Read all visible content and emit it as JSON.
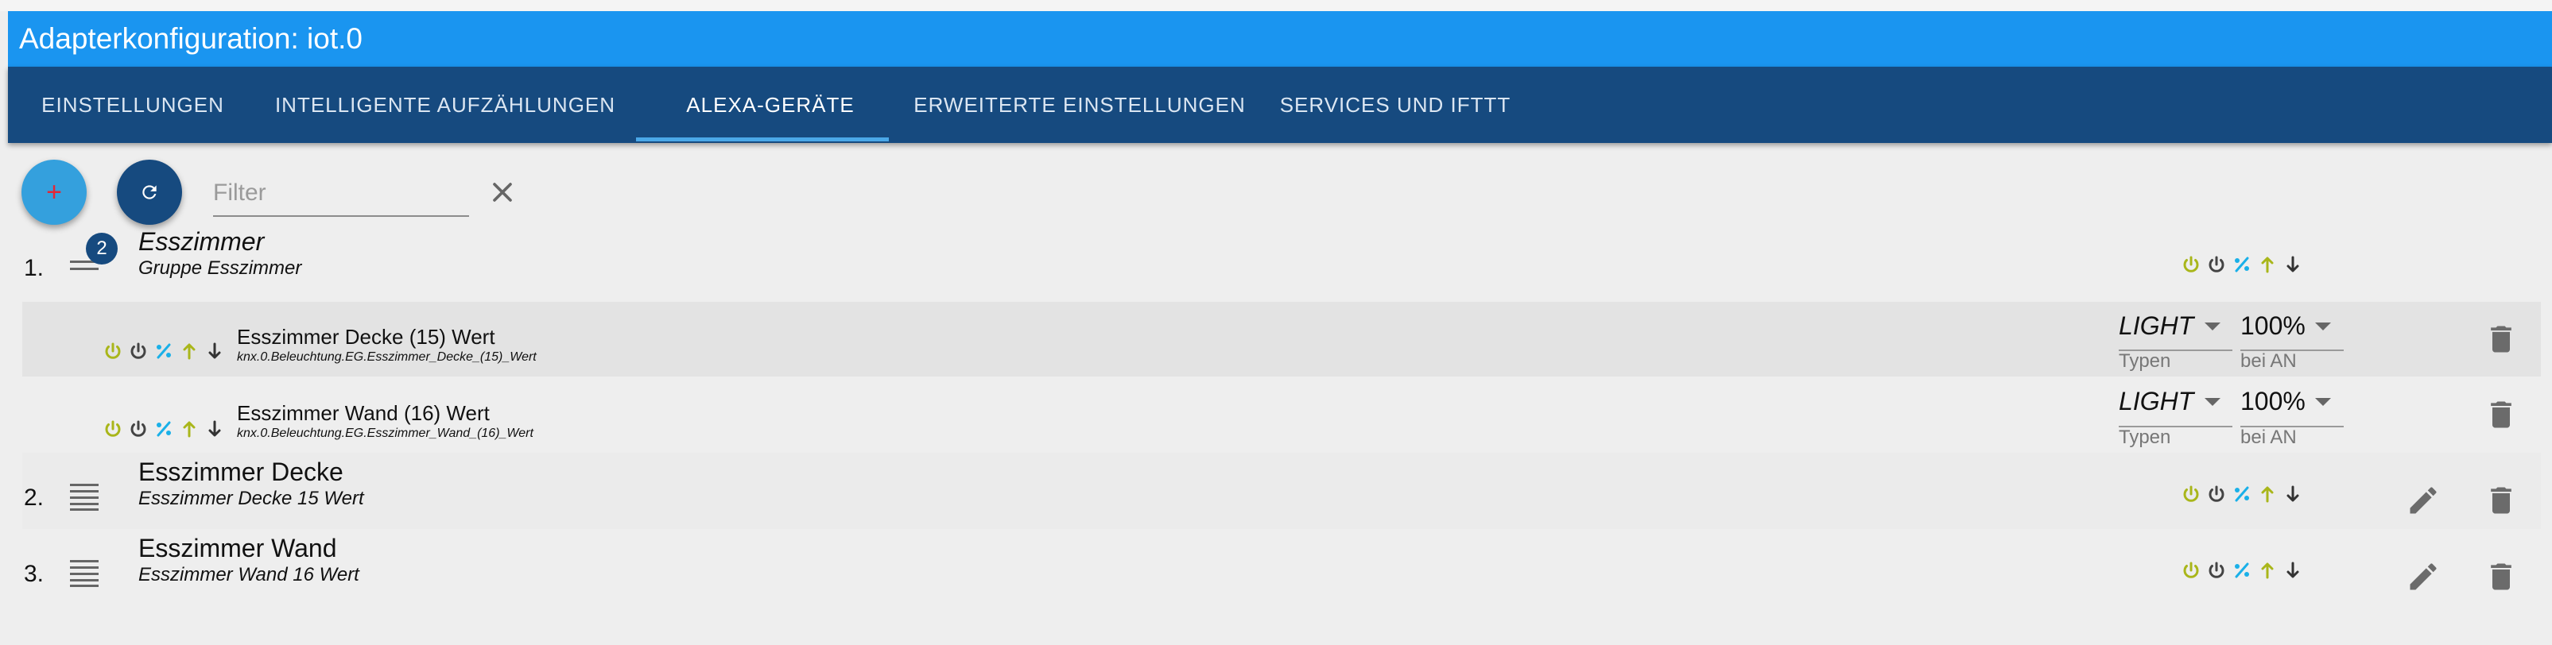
{
  "window": {
    "title": "Adapterkonfiguration: iot.0"
  },
  "tabs": [
    {
      "label": "EINSTELLUNGEN"
    },
    {
      "label": "INTELLIGENTE AUFZÄHLUNGEN"
    },
    {
      "label": "ALEXA-GERÄTE"
    },
    {
      "label": "ERWEITERTE EINSTELLUNGEN"
    },
    {
      "label": "SERVICES UND IFTTT"
    }
  ],
  "active_tab": "ALEXA-GERÄTE",
  "toolbar": {
    "add_label": "+",
    "filter_placeholder": "Filter",
    "filter_value": ""
  },
  "colors": {
    "accent_header": "#1a95f0",
    "tab_bar": "#164a7f",
    "icon_on": "#a9b61a",
    "icon_off": "#444444",
    "icon_percent": "#1ab0e8",
    "icon_up": "#a9b61a",
    "icon_down": "#333333"
  },
  "devices": [
    {
      "number": "1.",
      "name": "Esszimmer",
      "subtitle": "Gruppe Esszimmer",
      "count_badge": "2",
      "name_italic": true,
      "children": [
        {
          "name": "Esszimmer Decke (15) Wert",
          "path": "knx.0.Beleuchtung.EG.Esszimmer_Decke_(15)_Wert",
          "type_value": "LIGHT",
          "type_label": "Typen",
          "on_value": "100%",
          "on_label": "bei AN"
        },
        {
          "name": "Esszimmer Wand (16) Wert",
          "path": "knx.0.Beleuchtung.EG.Esszimmer_Wand_(16)_Wert",
          "type_value": "LIGHT",
          "type_label": "Typen",
          "on_value": "100%",
          "on_label": "bei AN"
        }
      ]
    },
    {
      "number": "2.",
      "name": "Esszimmer Decke",
      "subtitle": "Esszimmer Decke 15 Wert"
    },
    {
      "number": "3.",
      "name": "Esszimmer Wand",
      "subtitle": "Esszimmer Wand 16 Wert"
    }
  ],
  "icons": {
    "add": "plus-icon",
    "refresh": "refresh-icon",
    "clear": "close-icon",
    "drag": "drag-handle-icon",
    "power_on": "power-on-icon",
    "power_off": "power-off-icon",
    "percent": "percent-icon",
    "up": "arrow-up-icon",
    "down": "arrow-down-icon",
    "edit": "pencil-icon",
    "delete": "trash-icon"
  }
}
